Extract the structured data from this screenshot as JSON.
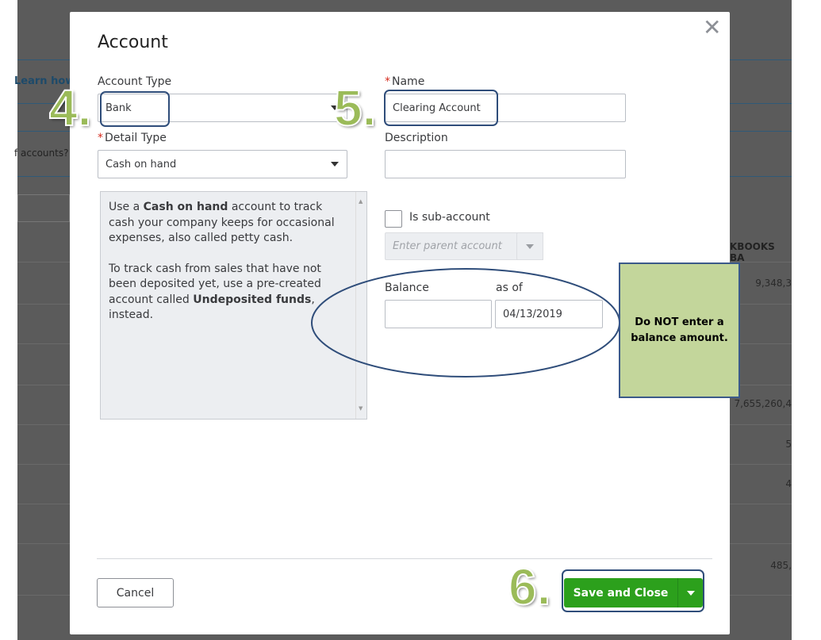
{
  "background": {
    "learn_link": "Learn how",
    "accounts_text": "f accounts?",
    "column_header": "KBOOKS BA",
    "balances": [
      "9,348,3",
      "7,655,260,4",
      "5",
      "4",
      "485,"
    ]
  },
  "dialog": {
    "title": "Account",
    "account_type": {
      "label": "Account Type",
      "value": "Bank"
    },
    "name": {
      "required": "*",
      "label": "Name",
      "value": "Clearing Account"
    },
    "detail_type": {
      "required": "*",
      "label": "Detail Type",
      "value": "Cash on hand"
    },
    "description": {
      "label": "Description",
      "value": ""
    },
    "help": {
      "p1_a": "Use a ",
      "p1_b": "Cash on hand",
      "p1_c": " account to track cash your company keeps for occasional expenses, also called petty cash.",
      "p2_a": "To track cash from sales that have not been deposited yet, use a pre-created account called ",
      "p2_b": "Undeposited funds",
      "p2_c": ", instead."
    },
    "sub_account": {
      "label": "Is sub-account",
      "checked": false,
      "parent_placeholder": "Enter parent account"
    },
    "balance": {
      "label": "Balance",
      "value": ""
    },
    "as_of": {
      "label": "as of",
      "value": "04/13/2019"
    },
    "cancel": "Cancel",
    "save_close": "Save and Close"
  },
  "annotations": {
    "step4": "4.",
    "step5": "5.",
    "step6": "6.",
    "callout": "Do NOT enter a balance amount."
  },
  "colors": {
    "green_button": "#2ca01c",
    "annotation_green": "#9bbb59",
    "callout_fill": "#c3d69b",
    "annotation_blue": "#2f4d7a"
  }
}
